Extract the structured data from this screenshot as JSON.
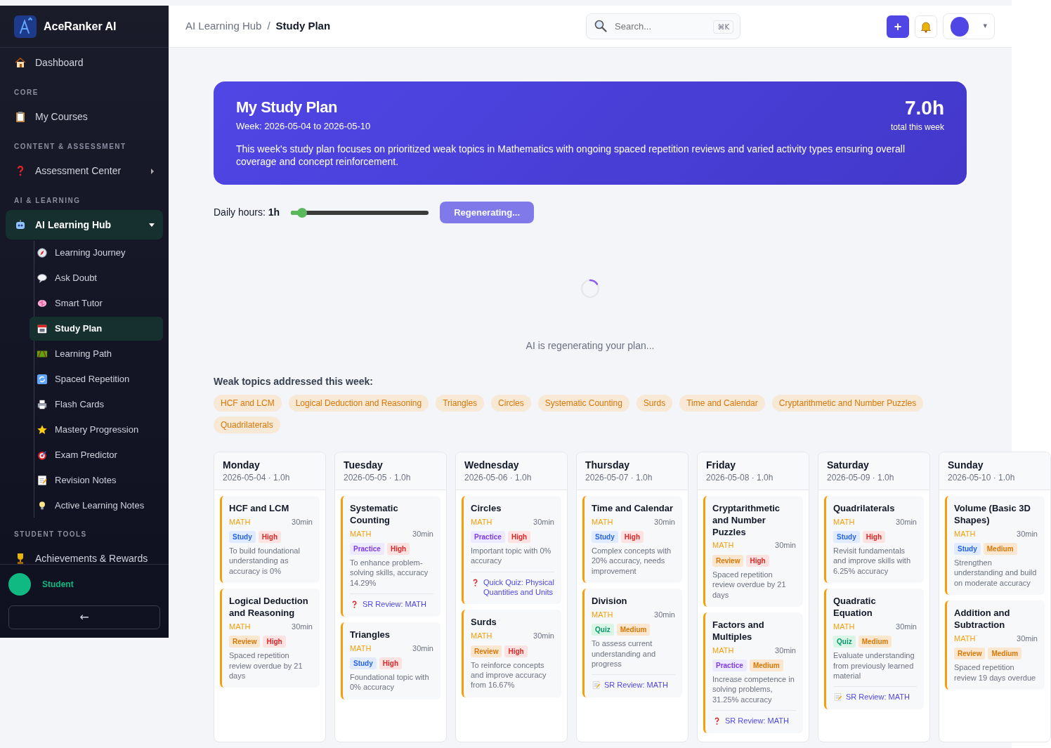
{
  "sidebar": {
    "brand": "AceRanker AI",
    "nav": [
      {
        "kind": "item",
        "label": "Dashboard",
        "selected": false
      },
      {
        "kind": "heading",
        "label": "CORE"
      },
      {
        "kind": "item",
        "label": "My Courses",
        "selected": false
      },
      {
        "kind": "heading",
        "label": "CONTENT & ASSESSMENT"
      },
      {
        "kind": "item",
        "label": "Assessment Center",
        "selected": false,
        "expanded": false
      },
      {
        "kind": "heading",
        "label": "AI & LEARNING"
      },
      {
        "kind": "item",
        "label": "AI Learning Hub",
        "selected": true,
        "expanded": true,
        "children": [
          {
            "label": "Learning Journey",
            "selected": false
          },
          {
            "label": "Ask Doubt",
            "selected": false
          },
          {
            "label": "Smart Tutor",
            "selected": false
          },
          {
            "label": "Study Plan",
            "selected": true
          },
          {
            "label": "Learning Path",
            "selected": false
          },
          {
            "label": "Spaced Repetition",
            "selected": false
          },
          {
            "label": "Flash Cards",
            "selected": false
          },
          {
            "label": "Mastery Progression",
            "selected": false
          },
          {
            "label": "Exam Predictor",
            "selected": false
          },
          {
            "label": "Revision Notes",
            "selected": false
          },
          {
            "label": "Active Learning Notes",
            "selected": false
          }
        ]
      },
      {
        "kind": "heading",
        "label": "STUDENT TOOLS"
      },
      {
        "kind": "item",
        "label": "Achievements & Rewards",
        "selected": false
      }
    ],
    "user": "Student",
    "back_button": "←"
  },
  "header": {
    "breadcrumb": [
      "AI Learning Hub",
      "Study Plan"
    ],
    "separator": "/",
    "search": {
      "placeholder": "Search...",
      "shortcut": "⌘K"
    },
    "add_button": "+",
    "menu_caret": "▾"
  },
  "banner": {
    "title": "My Study Plan",
    "week": "Week: 2026-05-04 to 2026-05-10",
    "total": "7.0h",
    "total_label": "total this week",
    "summary": "This week's study plan focuses on prioritized weak topics in Mathematics with ongoing spaced repetition reviews and varied activity types ensuring overall coverage and concept reinforcement."
  },
  "controls": {
    "daily_label": "Daily hours: **1h**",
    "level": 0.08,
    "button": "Regenerating...",
    "disabled": true
  },
  "loading": "AI is regenerating your plan...",
  "weak_topics": {
    "heading": "Weak topics addressed this week:",
    "topics": [
      "HCF and LCM",
      "Logical Deduction and Reasoning",
      "Triangles",
      "Circles",
      "Systematic Counting",
      "Surds",
      "Time and Calendar",
      "Cryptarithmetic and Number Puzzles",
      "Quadrilaterals"
    ]
  },
  "days": [
    {
      "name": "Monday",
      "date": "2026-05-04 · 1.0h",
      "items": [
        {
          "title": "HCF and LCM",
          "subject": "MATH",
          "duration": "30min",
          "type": {
            "label": "Study",
            "kind": "study"
          },
          "priority": {
            "label": "High",
            "kind": "high"
          },
          "reason": "To build foundational understanding as accuracy is 0%"
        },
        {
          "title": "Logical Deduction and Reasoning",
          "subject": "MATH",
          "duration": "30min",
          "type": {
            "label": "Review",
            "kind": "review"
          },
          "priority": {
            "label": "High",
            "kind": "high"
          },
          "reason": "Spaced repetition review overdue by 21 days"
        }
      ]
    },
    {
      "name": "Tuesday",
      "date": "2026-05-05 · 1.0h",
      "items": [
        {
          "title": "Systematic Counting",
          "subject": "MATH",
          "duration": "30min",
          "type": {
            "label": "Practice",
            "kind": "practice"
          },
          "priority": {
            "label": "High",
            "kind": "high"
          },
          "reason": "To enhance problem-solving skills, accuracy 14.29%",
          "link": {
            "label": "SR Review: MATH",
            "kind": "quiz"
          }
        },
        {
          "title": "Triangles",
          "subject": "MATH",
          "duration": "30min",
          "type": {
            "label": "Study",
            "kind": "study"
          },
          "priority": {
            "label": "High",
            "kind": "high"
          },
          "reason": "Foundational topic with 0% accuracy"
        }
      ]
    },
    {
      "name": "Wednesday",
      "date": "2026-05-06 · 1.0h",
      "items": [
        {
          "title": "Circles",
          "subject": "MATH",
          "duration": "30min",
          "type": {
            "label": "Practice",
            "kind": "practice"
          },
          "priority": {
            "label": "High",
            "kind": "high"
          },
          "reason": "Important topic with 0% accuracy",
          "link": {
            "label": "Quick Quiz: Physical Quantities and Units",
            "kind": "quiz"
          }
        },
        {
          "title": "Surds",
          "subject": "MATH",
          "duration": "30min",
          "type": {
            "label": "Review",
            "kind": "review"
          },
          "priority": {
            "label": "High",
            "kind": "high"
          },
          "reason": "To reinforce concepts and improve accuracy from 16.67%"
        }
      ]
    },
    {
      "name": "Thursday",
      "date": "2026-05-07 · 1.0h",
      "items": [
        {
          "title": "Time and Calendar",
          "subject": "MATH",
          "duration": "30min",
          "type": {
            "label": "Study",
            "kind": "study"
          },
          "priority": {
            "label": "High",
            "kind": "high"
          },
          "reason": "Complex concepts with 20% accuracy, needs improvement"
        },
        {
          "title": "Division",
          "subject": "MATH",
          "duration": "30min",
          "type": {
            "label": "Quiz",
            "kind": "quiz"
          },
          "priority": {
            "label": "Medium",
            "kind": "medium"
          },
          "reason": "To assess current understanding and progress",
          "link": {
            "label": "SR Review: MATH",
            "kind": "note"
          }
        }
      ]
    },
    {
      "name": "Friday",
      "date": "2026-05-08 · 1.0h",
      "items": [
        {
          "title": "Cryptarithmetic and Number Puzzles",
          "subject": "MATH",
          "duration": "30min",
          "type": {
            "label": "Review",
            "kind": "review"
          },
          "priority": {
            "label": "High",
            "kind": "high"
          },
          "reason": "Spaced repetition review overdue by 21 days"
        },
        {
          "title": "Factors and Multiples",
          "subject": "MATH",
          "duration": "30min",
          "type": {
            "label": "Practice",
            "kind": "practice"
          },
          "priority": {
            "label": "Medium",
            "kind": "medium"
          },
          "reason": "Increase competence in solving problems, 31.25% accuracy",
          "link": {
            "label": "SR Review: MATH",
            "kind": "quiz"
          }
        }
      ]
    },
    {
      "name": "Saturday",
      "date": "2026-05-09 · 1.0h",
      "items": [
        {
          "title": "Quadrilaterals",
          "subject": "MATH",
          "duration": "30min",
          "type": {
            "label": "Study",
            "kind": "study"
          },
          "priority": {
            "label": "High",
            "kind": "high"
          },
          "reason": "Revisit fundamentals and improve skills with 6.25% accuracy"
        },
        {
          "title": "Quadratic Equation",
          "subject": "MATH",
          "duration": "30min",
          "type": {
            "label": "Quiz",
            "kind": "quiz"
          },
          "priority": {
            "label": "Medium",
            "kind": "medium"
          },
          "reason": "Evaluate understanding from previously learned material",
          "link": {
            "label": "SR Review: MATH",
            "kind": "note"
          }
        }
      ]
    },
    {
      "name": "Sunday",
      "date": "2026-05-10 · 1.0h",
      "items": [
        {
          "title": "Volume (Basic 3D Shapes)",
          "subject": "MATH",
          "duration": "30min",
          "type": {
            "label": "Study",
            "kind": "study"
          },
          "priority": {
            "label": "Medium",
            "kind": "medium"
          },
          "reason": "Strengthen understanding and build on moderate accuracy"
        },
        {
          "title": "Addition and Subtraction",
          "subject": "MATH",
          "duration": "30min",
          "type": {
            "label": "Review",
            "kind": "review"
          },
          "priority": {
            "label": "Medium",
            "kind": "medium"
          },
          "reason": "Spaced repetition review 19 days overdue"
        }
      ]
    }
  ]
}
